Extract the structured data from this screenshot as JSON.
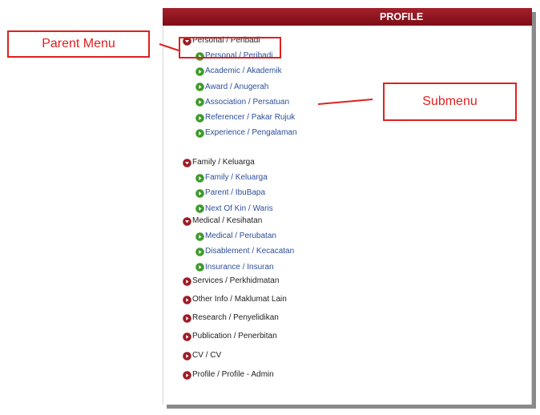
{
  "panel": {
    "title": "PROFILE",
    "accent_color": "#8f1520"
  },
  "menu": [
    {
      "label": "Personal / Peribadi",
      "state": "expanded",
      "children": [
        "Personal / Peribadi",
        "Academic / Akademik",
        "Award / Anugerah",
        "Association / Persatuan",
        "Referencer / Pakar Rujuk",
        "Experience / Pengalaman"
      ]
    },
    {
      "label": "Family / Keluarga",
      "state": "expanded",
      "children": [
        "Family / Keluarga",
        "Parent / IbuBapa",
        "Next Of Kin / Waris"
      ]
    },
    {
      "label": "Medical / Kesihatan",
      "state": "expanded",
      "children": [
        "Medical / Perubatan",
        "Disablement / Kecacatan",
        "Insurance / Insuran"
      ]
    },
    {
      "label": "Services / Perkhidmatan",
      "state": "collapsed",
      "children": []
    },
    {
      "label": "Other Info / Maklumat Lain",
      "state": "collapsed",
      "children": []
    },
    {
      "label": "Research / Penyelidikan",
      "state": "collapsed",
      "children": []
    },
    {
      "label": "Publication / Penerbitan",
      "state": "collapsed",
      "children": []
    },
    {
      "label": "CV / CV",
      "state": "collapsed",
      "children": []
    },
    {
      "label": "Profile / Profile - Admin",
      "state": "collapsed",
      "children": []
    }
  ],
  "annotations": {
    "parent_menu_label": "Parent Menu",
    "submenu_label": "Submenu",
    "color": "#e02020"
  },
  "icons": {
    "expanded": "chevron-down-circle-icon",
    "collapsed": "chevron-right-circle-icon",
    "submenu": "chevron-right-circle-green-icon",
    "parent_color": "#9c1c26",
    "submenu_color": "#3f9a2c"
  }
}
